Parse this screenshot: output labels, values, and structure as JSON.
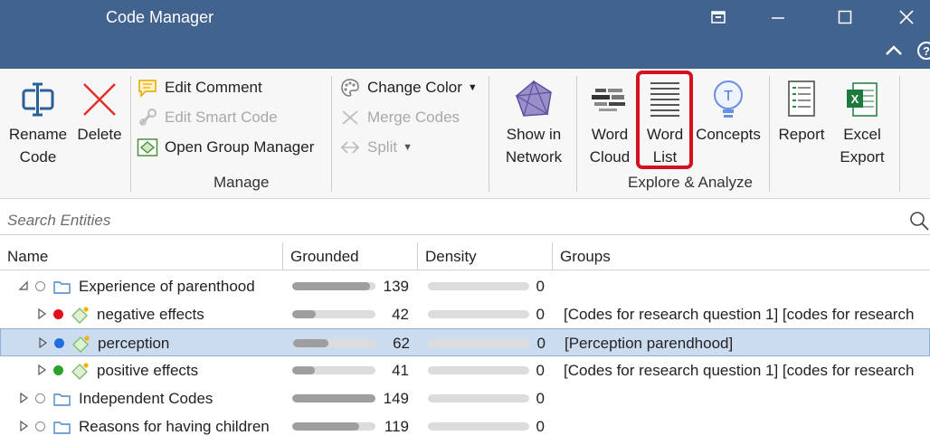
{
  "window": {
    "title": "Code Manager"
  },
  "ribbon": {
    "rename_code": [
      "Rename",
      "Code"
    ],
    "delete": "Delete",
    "edit_comment": "Edit Comment",
    "edit_smart_code": "Edit Smart Code",
    "open_group_manager": "Open Group Manager",
    "change_color": "Change Color",
    "merge_codes": "Merge Codes",
    "split": "Split",
    "show_in_network": [
      "Show in",
      "Network"
    ],
    "word_cloud": [
      "Word",
      "Cloud"
    ],
    "word_list": [
      "Word",
      "List"
    ],
    "concepts": "Concepts",
    "report": "Report",
    "excel_export": [
      "Excel",
      "Export"
    ],
    "group_manage": "Manage",
    "group_explore": "Explore & Analyze",
    "help_glyph": "?"
  },
  "search": {
    "placeholder": "Search Entities"
  },
  "table": {
    "columns": [
      "Name",
      "Grounded",
      "Density",
      "Groups"
    ],
    "rows": [
      {
        "name": "Experience of parenthood",
        "grounded": "139",
        "grounded_fraction": 0.93,
        "density": "0",
        "groups": "",
        "kind": "folder",
        "expander": "open",
        "dot": "empty",
        "selected": false
      },
      {
        "name": "negative effects",
        "grounded": "42",
        "grounded_fraction": 0.28,
        "density": "0",
        "groups": "[Codes for research question 1] [codes for research",
        "kind": "code",
        "expander": "closed",
        "dot": "#e0111b",
        "selected": false
      },
      {
        "name": "perception",
        "grounded": "62",
        "grounded_fraction": 0.42,
        "density": "0",
        "groups": "[Perception parendhood]",
        "kind": "code",
        "expander": "closed",
        "dot": "#1f6fe0",
        "selected": true
      },
      {
        "name": "positive effects",
        "grounded": "41",
        "grounded_fraction": 0.27,
        "density": "0",
        "groups": "[Codes for research question 1] [codes for research",
        "kind": "code",
        "expander": "closed",
        "dot": "#2aa12a",
        "selected": false
      },
      {
        "name": "Independent Codes",
        "grounded": "149",
        "grounded_fraction": 1.0,
        "density": "0",
        "groups": "",
        "kind": "folder",
        "expander": "closed",
        "dot": "empty",
        "selected": false
      },
      {
        "name": "Reasons for having children",
        "grounded": "119",
        "grounded_fraction": 0.8,
        "density": "0",
        "groups": "",
        "kind": "folder",
        "expander": "closed",
        "dot": "empty",
        "selected": false
      }
    ]
  },
  "colors": {
    "titlebar": "#41638d",
    "highlight": "#d4121d",
    "selection": "#ccdcf0"
  }
}
